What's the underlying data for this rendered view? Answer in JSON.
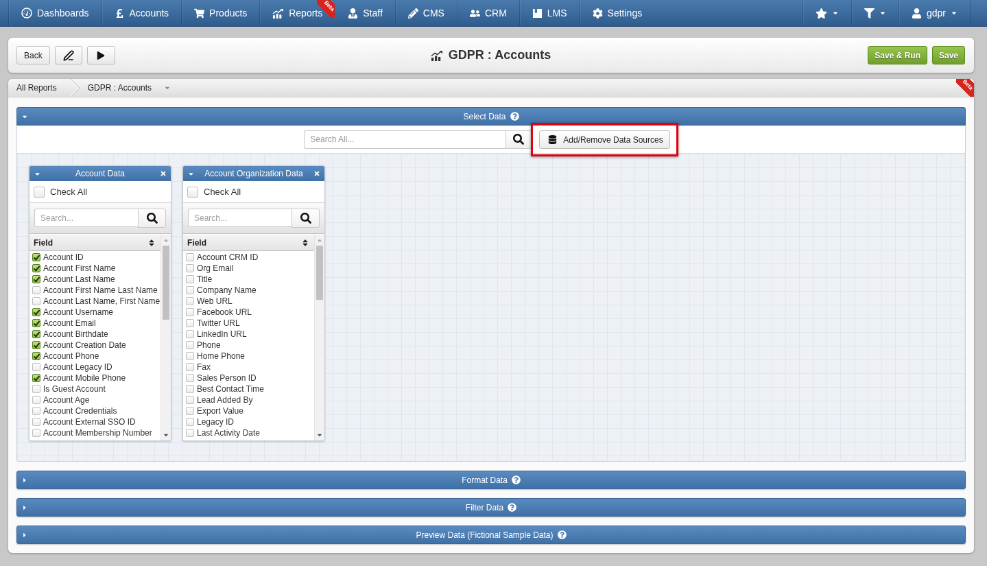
{
  "top_nav": {
    "items": [
      {
        "label": "Dashboards"
      },
      {
        "label": "Accounts"
      },
      {
        "label": "Products"
      },
      {
        "label": "Reports",
        "badge": "Beta"
      },
      {
        "label": "Staff"
      },
      {
        "label": "CMS"
      },
      {
        "label": "CRM"
      },
      {
        "label": "LMS"
      },
      {
        "label": "Settings"
      }
    ],
    "user_menu": {
      "label": "gdpr"
    }
  },
  "toolbar": {
    "back_button": "Back",
    "title": "GDPR : Accounts",
    "buttons": [
      "Save & Run",
      "Save"
    ]
  },
  "breadcrumb": {
    "items": [
      "All Reports",
      "GDPR : Accounts"
    ],
    "ribbon": "Beta"
  },
  "sections": [
    {
      "title": "Select Data",
      "expanded": true,
      "search": {
        "placeholder": "Search All..."
      },
      "add_button": {
        "label": "Add/Remove Data Sources",
        "highlighted": true
      },
      "sources": [
        {
          "title": "Account Data",
          "check_all": {
            "label": "Check All",
            "checked": false
          },
          "search": {
            "placeholder": "Search..."
          },
          "column": "Field",
          "fields": [
            {
              "label": "Account ID",
              "checked": true
            },
            {
              "label": "Account First Name",
              "checked": true
            },
            {
              "label": "Account Last Name",
              "checked": true
            },
            {
              "label": "Account First Name Last Name",
              "checked": false
            },
            {
              "label": "Account Last Name, First Name",
              "checked": false
            },
            {
              "label": "Account Username",
              "checked": true
            },
            {
              "label": "Account Email",
              "checked": true
            },
            {
              "label": "Account Birthdate",
              "checked": true
            },
            {
              "label": "Account Creation Date",
              "checked": true
            },
            {
              "label": "Account Phone",
              "checked": true
            },
            {
              "label": "Account Legacy ID",
              "checked": false
            },
            {
              "label": "Account Mobile Phone",
              "checked": true
            },
            {
              "label": "Is Guest Account",
              "checked": false
            },
            {
              "label": "Account Age",
              "checked": false
            },
            {
              "label": "Account Credentials",
              "checked": false
            },
            {
              "label": "Account External SSO ID",
              "checked": false
            },
            {
              "label": "Account Membership Number",
              "checked": false
            }
          ]
        },
        {
          "title": "Account Organization Data",
          "check_all": {
            "label": "Check All",
            "checked": false
          },
          "search": {
            "placeholder": "Search..."
          },
          "column": "Field",
          "fields": [
            {
              "label": "Account CRM ID",
              "checked": false
            },
            {
              "label": "Org Email",
              "checked": false
            },
            {
              "label": "Title",
              "checked": false
            },
            {
              "label": "Company Name",
              "checked": false
            },
            {
              "label": "Web URL",
              "checked": false
            },
            {
              "label": "Facebook URL",
              "checked": false
            },
            {
              "label": "Twitter URL",
              "checked": false
            },
            {
              "label": "LinkedIn URL",
              "checked": false
            },
            {
              "label": "Phone",
              "checked": false
            },
            {
              "label": "Home Phone",
              "checked": false
            },
            {
              "label": "Fax",
              "checked": false
            },
            {
              "label": "Sales Person ID",
              "checked": false
            },
            {
              "label": "Best Contact Time",
              "checked": false
            },
            {
              "label": "Lead Added By",
              "checked": false
            },
            {
              "label": "Export Value",
              "checked": false
            },
            {
              "label": "Legacy ID",
              "checked": false
            },
            {
              "label": "Last Activity Date",
              "checked": false
            }
          ]
        }
      ]
    },
    {
      "title": "Format Data",
      "expanded": false
    },
    {
      "title": "Filter Data",
      "expanded": false
    },
    {
      "title": "Preview Data (Fictional Sample Data)",
      "expanded": false
    }
  ]
}
